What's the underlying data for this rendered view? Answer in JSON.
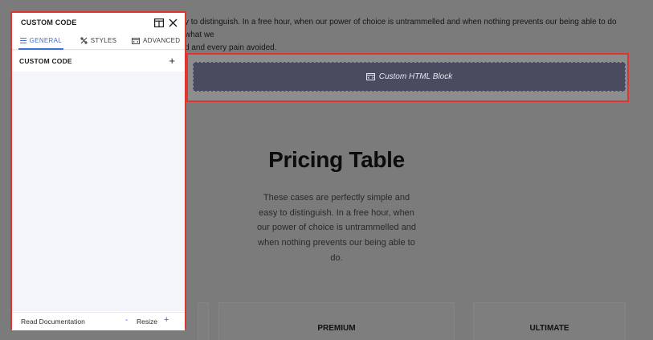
{
  "panel": {
    "title": "CUSTOM CODE",
    "tabs": [
      {
        "label": "GENERAL",
        "icon": "menu-icon",
        "active": true
      },
      {
        "label": "STYLES",
        "icon": "styles-icon",
        "active": false
      },
      {
        "label": "ADVANCED",
        "icon": "advanced-icon",
        "active": false
      }
    ],
    "section": {
      "label": "CUSTOM CODE",
      "toggle": "+"
    },
    "footer": {
      "doc_link": "Read Documentation",
      "resize_minus": "-",
      "resize_label": "Resize",
      "resize_plus": "+"
    }
  },
  "page": {
    "intro_line1": "y to distinguish. In a free hour, when our power of choice is untrammelled and when nothing prevents our being able to do what we",
    "intro_line2": "d and every pain avoided.",
    "html_block_label": "Custom HTML Block",
    "pricing_title": "Pricing Table",
    "pricing_desc": "These cases are perfectly simple and easy to distinguish. In a free hour, when our power of choice is untrammelled and when nothing prevents our being able to do.",
    "plans": [
      "PREMIUM",
      "ULTIMATE"
    ]
  },
  "colors": {
    "accent": "#3f6fd8",
    "selection_outline": "#e2352f",
    "resize_controls": "#5d4fd6",
    "html_block_bg": "#4a4b5e",
    "overlay": "#7b7b7b"
  }
}
